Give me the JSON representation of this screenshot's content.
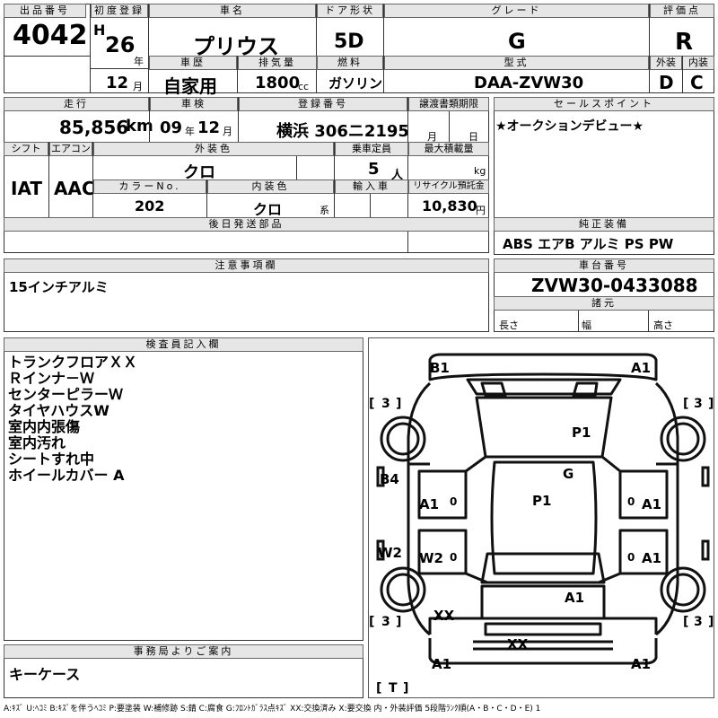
{
  "labels": {
    "lot_no": "出品番号",
    "first_reg": "初度登録",
    "car_name": "車名",
    "door": "ドア形状",
    "grade": "グレード",
    "score": "評価点",
    "history": "車歴",
    "displacement": "排気量",
    "fuel": "燃料",
    "model_code": "型式",
    "exterior": "外装",
    "interior": "内装",
    "mileage": "走行",
    "inspection": "車検",
    "reg_no": "登録番号",
    "transfer": "譲渡書類期限",
    "sales_point": "セールスポイント",
    "shift": "シフト",
    "aircon": "エアコン",
    "ext_color": "外装色",
    "capacity": "乗車定員",
    "max_load": "最大積載量",
    "color_no": "カラーNo.",
    "int_color": "内装色",
    "import": "輸入車",
    "recycle": "リサイクル預託金",
    "later_parts": "後日発送部品",
    "equipment": "純正装備",
    "caution": "注意事項欄",
    "chassis": "車台番号",
    "spec": "諸元",
    "length": "長さ",
    "width": "幅",
    "height": "高さ",
    "inspector": "検査員記入欄",
    "office": "事務局よりご案内"
  },
  "lot_no": "4042",
  "era": "H",
  "year": "26",
  "year_unit": "年",
  "month": "12",
  "month_unit": "月",
  "car_name": "プリウス",
  "door": "5D",
  "grade": "G",
  "score": "R",
  "history": "自家用",
  "displacement": "1800",
  "displacement_unit": "cc",
  "fuel": "ガソリン",
  "model_code": "DAA-ZVW30",
  "exterior_grade": "D",
  "interior_grade": "C",
  "mileage": "85,856",
  "mileage_unit": "km",
  "inspection_year": "09",
  "inspection_month": "12",
  "reg_no": "横浜 306ニ2195",
  "transfer_month": "月",
  "transfer_day": "日",
  "sales_point": "★オークションデビュー★",
  "shift": "IAT",
  "aircon": "AAC",
  "ext_color": "クロ",
  "capacity": "5",
  "capacity_unit": "人",
  "max_load_unit": "kg",
  "color_no": "202",
  "int_color": "クロ",
  "int_color_unit": "系",
  "recycle": "10,830",
  "recycle_unit": "円",
  "equipment": "ABS エアB アルミ PS PW",
  "caution": "15インチアルミ",
  "chassis": "ZVW30-0433088",
  "inspector_notes": [
    "トランクフロアＸＸ",
    "Ｒインナ－Ｗ",
    "センターピラーＷ",
    "タイヤハウスW",
    "室内内張傷",
    "室内汚れ",
    "シートすれ中",
    "ホイールカバー A"
  ],
  "office_note": "キーケース",
  "diagram": {
    "B1": "B1",
    "A1_tr": "A1",
    "P1_top": "P1",
    "G": "G",
    "P1_mid": "P1",
    "B4": "B4",
    "A1_l": "A1",
    "A1_r1": "A1",
    "W2_side": "W2",
    "W2_in": "W2",
    "A1_r2": "A1",
    "A1_low": "A1",
    "XX1": "XX",
    "XX2": "XX",
    "A1_bl": "A1",
    "A1_br": "A1",
    "tire": "3",
    "spare": "T"
  },
  "legend": "A:ｷｽﾞ U:ﾍｺﾐ B:ｷｽﾞを伴うﾍｺﾐ P:要塗装 W:補修跡 S:錆 C:腐食 G:ﾌﾛﾝﾄｶﾞﾗｽ点ｷｽﾞ XX:交換済み X:要交換 内・外装評価 5段階ﾗﾝｸ順(A・B・C・D・E) 1"
}
